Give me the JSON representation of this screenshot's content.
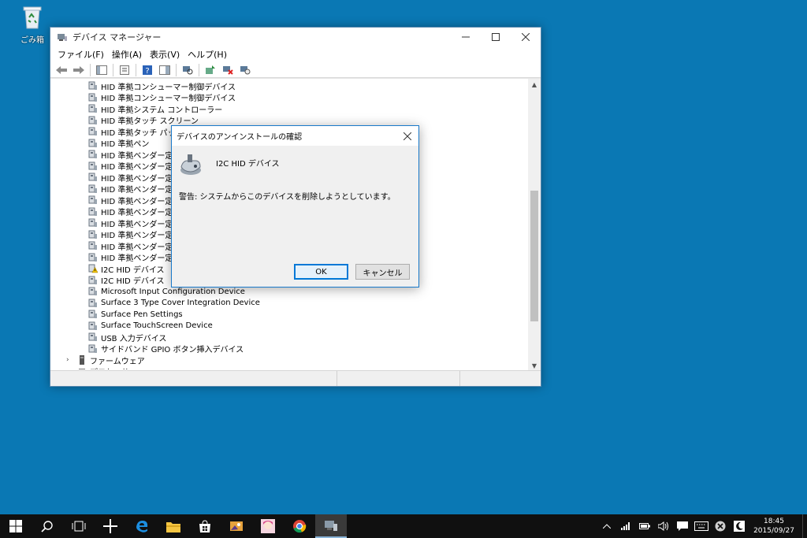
{
  "desktop": {
    "recycle_bin_label": "ごみ箱"
  },
  "window": {
    "title": "デバイス マネージャー",
    "menu": [
      "ファイル(F)",
      "操作(A)",
      "表示(V)",
      "ヘルプ(H)"
    ],
    "tree_items": [
      {
        "label": "HID 準拠コンシューマー制御デバイス",
        "level": 2
      },
      {
        "label": "HID 準拠コンシューマー制御デバイス",
        "level": 2
      },
      {
        "label": "HID 準拠システム コントローラー",
        "level": 2
      },
      {
        "label": "HID 準拠タッチ スクリーン",
        "level": 2
      },
      {
        "label": "HID 準拠タッチ パッド",
        "level": 2
      },
      {
        "label": "HID 準拠ペン",
        "level": 2
      },
      {
        "label": "HID 準拠ベンダー定義",
        "level": 2
      },
      {
        "label": "HID 準拠ベンダー定義",
        "level": 2
      },
      {
        "label": "HID 準拠ベンダー定義",
        "level": 2
      },
      {
        "label": "HID 準拠ベンダー定義",
        "level": 2
      },
      {
        "label": "HID 準拠ベンダー定義",
        "level": 2
      },
      {
        "label": "HID 準拠ベンダー定義",
        "level": 2
      },
      {
        "label": "HID 準拠ベンダー定義",
        "level": 2
      },
      {
        "label": "HID 準拠ベンダー定義",
        "level": 2
      },
      {
        "label": "HID 準拠ベンダー定義",
        "level": 2
      },
      {
        "label": "HID 準拠ベンダー定義",
        "level": 2
      },
      {
        "label": "I2C HID デバイス",
        "level": 2,
        "warning": true
      },
      {
        "label": "I2C HID デバイス",
        "level": 2
      },
      {
        "label": "Microsoft Input Configuration Device",
        "level": 2
      },
      {
        "label": "Surface 3 Type Cover Integration Device",
        "level": 2
      },
      {
        "label": "Surface Pen Settings",
        "level": 2
      },
      {
        "label": "Surface TouchScreen Device",
        "level": 2
      },
      {
        "label": "USB 入力デバイス",
        "level": 2
      },
      {
        "label": "サイドバンド GPIO ボタン挿入デバイス",
        "level": 2
      },
      {
        "label": "ファームウェア",
        "level": 1
      },
      {
        "label": "プロセッサ",
        "level": 1
      }
    ]
  },
  "dialog": {
    "title": "デバイスのアンインストールの確認",
    "device_name": "I2C HID デバイス",
    "warning": "警告: システムからこのデバイスを削除しようとしています。",
    "ok_label": "OK",
    "cancel_label": "キャンセル"
  },
  "clock": {
    "time": "18:45",
    "date": "2015/09/27"
  },
  "colors": {
    "desktop": "#0a78b4",
    "accent": "#0078d7",
    "taskbar": "#101010"
  }
}
